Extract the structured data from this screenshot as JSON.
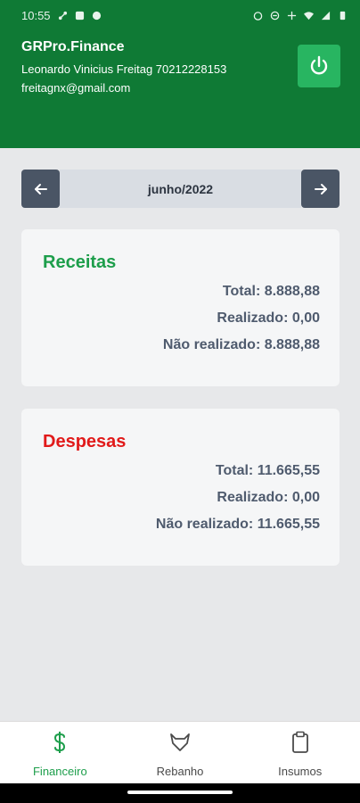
{
  "status_bar": {
    "time": "10:55"
  },
  "header": {
    "app_title": "GRPro.Finance",
    "user_name": "Leonardo Vinicius Freitag 70212228153",
    "user_email": "freitagnx@gmail.com"
  },
  "month_nav": {
    "label": "junho/2022"
  },
  "receitas": {
    "title": "Receitas",
    "total": "Total: 8.888,88",
    "realizado": "Realizado: 0,00",
    "nao_realizado": "Não realizado: 8.888,88"
  },
  "despesas": {
    "title": "Despesas",
    "total": "Total: 11.665,55",
    "realizado": "Realizado: 0,00",
    "nao_realizado": "Não realizado: 11.665,55"
  },
  "bottom_nav": {
    "tabs": [
      {
        "label": "Financeiro",
        "icon": "dollar-icon",
        "active": true
      },
      {
        "label": "Rebanho",
        "icon": "cow-icon",
        "active": false
      },
      {
        "label": "Insumos",
        "icon": "clipboard-icon",
        "active": false
      }
    ]
  },
  "colors": {
    "primary": "#0f7a35",
    "power_button": "#28b561",
    "income": "#1d9e4b",
    "expense": "#e11a1a"
  }
}
